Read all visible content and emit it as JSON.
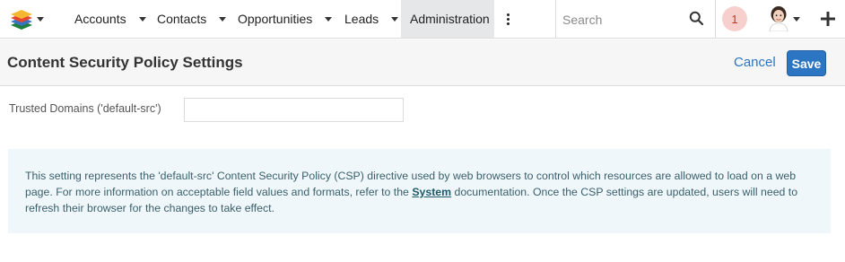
{
  "nav": {
    "tabs": [
      {
        "label": "Accounts"
      },
      {
        "label": "Contacts"
      },
      {
        "label": "Opportunities"
      },
      {
        "label": "Leads"
      },
      {
        "label": "Administration"
      }
    ],
    "search_placeholder": "Search",
    "notification_count": "1",
    "icons": {
      "logo": "stacked-layers-logo-icon",
      "more": "vertical-ellipsis-icon",
      "search": "search-icon",
      "plus": "plus-icon"
    }
  },
  "header": {
    "title": "Content Security Policy Settings",
    "cancel_label": "Cancel",
    "save_label": "Save"
  },
  "form": {
    "trusted_domains_label": "Trusted Domains ('default-src')",
    "trusted_domains_value": ""
  },
  "info": {
    "text_before": "This setting represents the 'default-src' Content Security Policy (CSP) directive used by web browsers to control which resources are allowed to load on a web page. For more information on acceptable field values and formats, refer to the ",
    "link_text": "System",
    "text_after": " documentation. Once the CSP settings are updated, users will need to refresh their browser for the changes to take effect."
  },
  "colors": {
    "accent": "#2c75c3",
    "active_tab_bg": "#e6e7e9",
    "badge_bg": "#f7cfcd",
    "info_bg": "#eff7fa"
  }
}
